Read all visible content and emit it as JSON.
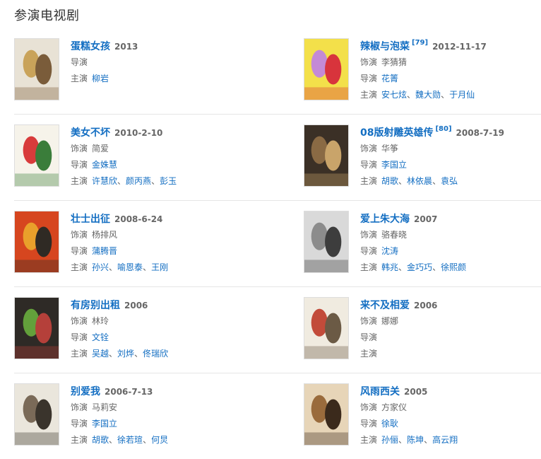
{
  "section": {
    "title": "参演电视剧"
  },
  "labels": {
    "role": "饰演",
    "director": "导演",
    "cast": "主演"
  },
  "items": [
    {
      "title": "蛋糕女孩",
      "ref": "",
      "year": "2013",
      "role": "",
      "director": "",
      "cast": [
        "柳岩"
      ],
      "poster_colors": [
        "#e8e2d5",
        "#c9a35a",
        "#7a5c3a"
      ]
    },
    {
      "title": "辣椒与泡菜",
      "ref": "[79]",
      "year": "2012-11-17",
      "role": "李猜猜",
      "director": "花箐",
      "cast": [
        "安七炫",
        "魏大勋",
        "于月仙"
      ],
      "poster_colors": [
        "#f3e04a",
        "#c48ad6",
        "#d8343c"
      ]
    },
    {
      "title": "美女不坏",
      "ref": "",
      "year": "2010-2-10",
      "role": "简爱",
      "director": "金姝慧",
      "cast": [
        "许慧欣",
        "颜丙燕",
        "彭玉"
      ],
      "poster_colors": [
        "#f6f3ea",
        "#d83b3b",
        "#3a7d3a"
      ]
    },
    {
      "title": "08版射雕英雄传",
      "ref": "[80]",
      "year": "2008-7-19",
      "role": "华筝",
      "director": "李国立",
      "cast": [
        "胡歌",
        "林依晨",
        "袁弘"
      ],
      "poster_colors": [
        "#3b3026",
        "#8a6a44",
        "#c9a46a"
      ]
    },
    {
      "title": "壮士出征",
      "ref": "",
      "year": "2008-6-24",
      "role": "杨排风",
      "director": "蒲腾晋",
      "cast": [
        "孙兴",
        "喻恩泰",
        "王刚"
      ],
      "poster_colors": [
        "#d6461f",
        "#e9a02b",
        "#2f2a24"
      ]
    },
    {
      "title": "爱上朱大海",
      "ref": "",
      "year": "2007",
      "role": "骆春晓",
      "director": "沈涛",
      "cast": [
        "韩兆",
        "金巧巧",
        "徐熙颜"
      ],
      "poster_colors": [
        "#d9d9d9",
        "#8c8c8c",
        "#3d3d3d"
      ]
    },
    {
      "title": "有房别出租",
      "ref": "",
      "year": "2006",
      "role": "林玲",
      "director": "文铨",
      "cast": [
        "吴越",
        "刘烨",
        "佟瑞欣"
      ],
      "poster_colors": [
        "#2e2a26",
        "#63a03b",
        "#b5403a"
      ]
    },
    {
      "title": "来不及相爱",
      "ref": "",
      "year": "2006",
      "role": "娜娜",
      "director": "",
      "cast": [],
      "poster_colors": [
        "#f0ebe0",
        "#c24b3a",
        "#6b5a45"
      ]
    },
    {
      "title": "别爱我",
      "ref": "",
      "year": "2006-7-13",
      "role": "马莉安",
      "director": "李国立",
      "cast": [
        "胡歌",
        "徐若瑄",
        "何炅"
      ],
      "poster_colors": [
        "#eae6dc",
        "#7a6a58",
        "#3a342c"
      ]
    },
    {
      "title": "风雨西关",
      "ref": "",
      "year": "2005",
      "role": "方家仪",
      "director": "徐耿",
      "cast": [
        "孙俪",
        "陈坤",
        "高云翔"
      ],
      "poster_colors": [
        "#e7d5b8",
        "#9a6b3c",
        "#3b2a1c"
      ]
    }
  ]
}
